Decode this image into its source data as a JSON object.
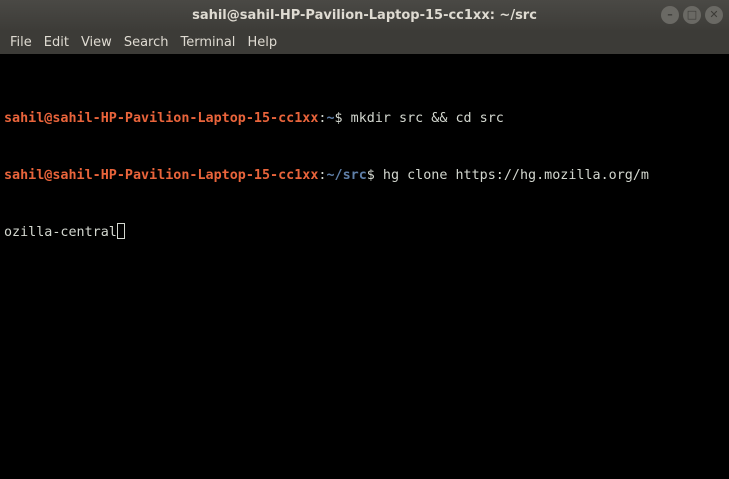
{
  "window": {
    "title": "sahil@sahil-HP-Pavilion-Laptop-15-cc1xx: ~/src",
    "controls": {
      "minimize": "–",
      "maximize": "□",
      "close": "✕"
    }
  },
  "menu": {
    "items": [
      "File",
      "Edit",
      "View",
      "Search",
      "Terminal",
      "Help"
    ]
  },
  "terminal": {
    "lines": [
      {
        "user": "sahil@sahil-HP-Pavilion-Laptop-15-cc1xx",
        "sep": ":",
        "path": "~",
        "prompt": "$ ",
        "command": "mkdir src && cd src"
      },
      {
        "user": "sahil@sahil-HP-Pavilion-Laptop-15-cc1xx",
        "sep": ":",
        "path": "~/src",
        "prompt": "$ ",
        "command": "hg clone https://hg.mozilla.org/m"
      }
    ],
    "wrap_text": "ozilla-central"
  },
  "colors": {
    "user": "#e9643b",
    "path": "#5f7fa8",
    "text": "#d3d7cf",
    "background": "#000000",
    "chrome": "#3c3b37"
  }
}
